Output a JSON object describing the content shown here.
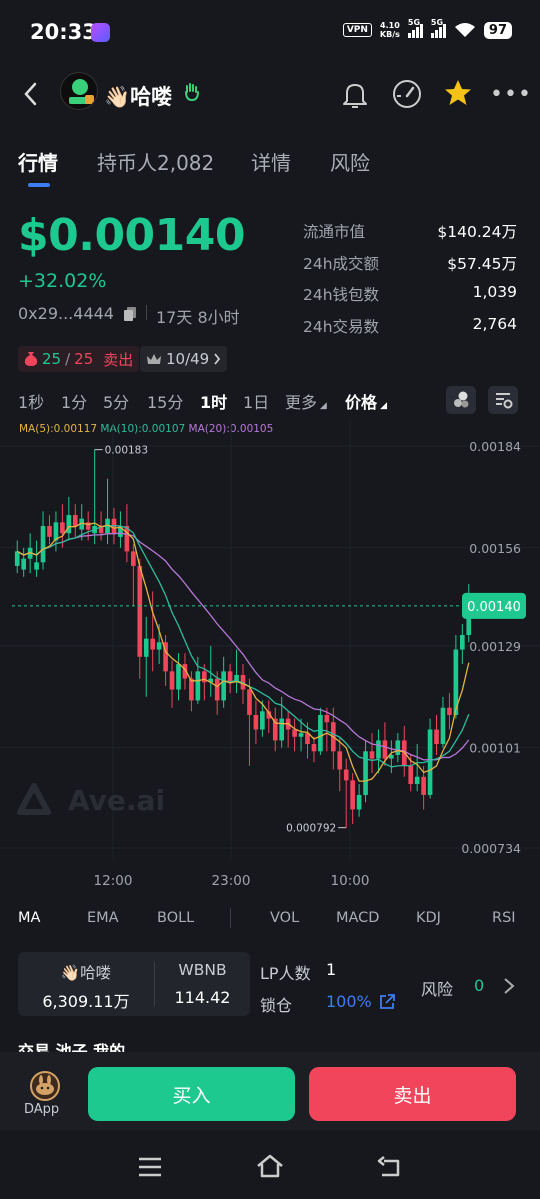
{
  "status_bar": {
    "time": "20:33",
    "vpn": "VPN",
    "speed_value": "4.10",
    "speed_unit": "KB/s",
    "signal_1": "5G",
    "signal_2": "5G",
    "battery": "97"
  },
  "header": {
    "token_name": "👋🏻哈喽",
    "avatar_text": "哈喽"
  },
  "tabs": [
    "行情",
    "持币人2,082",
    "详情",
    "风险"
  ],
  "price": {
    "value": "$0.00140",
    "change": "+32.02%",
    "address": "0x29...4444",
    "age": "17天 8小时"
  },
  "stats": [
    {
      "label": "流通市值",
      "value": "$140.24万"
    },
    {
      "label": "24h成交额",
      "value": "$57.45万"
    },
    {
      "label": "24h钱包数",
      "value": "1,039"
    },
    {
      "label": "24h交易数",
      "value": "2,764"
    }
  ],
  "badges": {
    "buy_count": "25",
    "sep": "/",
    "sell_count": "25",
    "sell_label": "卖出",
    "rank": "10/49"
  },
  "intervals": [
    "1秒",
    "1分",
    "5分",
    "15分",
    "1时",
    "1日",
    "更多",
    "价格"
  ],
  "ma_legend": {
    "ma5": "MA(5):0.00117",
    "ma10": "MA(10):0.00107",
    "ma20": "MA(20):0.00105"
  },
  "chart_data": {
    "type": "candlestick",
    "y_ticks": [
      "0.00184",
      "0.00156",
      "0.00129",
      "0.00101",
      "0.000734"
    ],
    "x_ticks": [
      "12:00",
      "23:00",
      "10:00"
    ],
    "current_price_label": "0.00140",
    "max_label": "0.00183",
    "min_label": "0.000792",
    "watermark": "Ave.ai",
    "ylim": [
      0.000734,
      0.00184
    ],
    "candles": [
      [
        0.00151,
        0.00155,
        0.00149,
        0.00158
      ],
      [
        0.0015,
        0.00153,
        0.00148,
        0.00156
      ],
      [
        0.00153,
        0.00156,
        0.00149,
        0.0016
      ],
      [
        0.0015,
        0.00152,
        0.00148,
        0.00158
      ],
      [
        0.00152,
        0.00162,
        0.0015,
        0.00166
      ],
      [
        0.00162,
        0.00159,
        0.00157,
        0.00165
      ],
      [
        0.00158,
        0.00163,
        0.00155,
        0.00166
      ],
      [
        0.00163,
        0.0016,
        0.00156,
        0.00168
      ],
      [
        0.0016,
        0.00165,
        0.00158,
        0.0017
      ],
      [
        0.00165,
        0.00162,
        0.00159,
        0.00168
      ],
      [
        0.00161,
        0.00164,
        0.00158,
        0.00168
      ],
      [
        0.00163,
        0.00161,
        0.00158,
        0.00166
      ],
      [
        0.0016,
        0.00162,
        0.00157,
        0.00183
      ],
      [
        0.00162,
        0.0016,
        0.00158,
        0.00166
      ],
      [
        0.0016,
        0.00164,
        0.00157,
        0.00175
      ],
      [
        0.00164,
        0.0016,
        0.00157,
        0.00167
      ],
      [
        0.00159,
        0.00162,
        0.00156,
        0.00166
      ],
      [
        0.00162,
        0.00155,
        0.00152,
        0.00168
      ],
      [
        0.00155,
        0.00151,
        0.0014,
        0.00157
      ],
      [
        0.00151,
        0.00126,
        0.0012,
        0.00153
      ],
      [
        0.00126,
        0.00131,
        0.00115,
        0.00137
      ],
      [
        0.00131,
        0.00128,
        0.00122,
        0.00144
      ],
      [
        0.00128,
        0.0013,
        0.00124,
        0.00135
      ],
      [
        0.0013,
        0.00122,
        0.00118,
        0.00132
      ],
      [
        0.00122,
        0.00117,
        0.00112,
        0.00125
      ],
      [
        0.00117,
        0.00124,
        0.00114,
        0.00127
      ],
      [
        0.00124,
        0.0012,
        0.00117,
        0.00127
      ],
      [
        0.0012,
        0.00114,
        0.00111,
        0.00122
      ],
      [
        0.00114,
        0.00122,
        0.00113,
        0.00126
      ],
      [
        0.00122,
        0.00119,
        0.00114,
        0.00124
      ],
      [
        0.00119,
        0.0012,
        0.00115,
        0.00129
      ],
      [
        0.0012,
        0.00114,
        0.0011,
        0.00122
      ],
      [
        0.00114,
        0.00122,
        0.00112,
        0.00126
      ],
      [
        0.00122,
        0.00119,
        0.00116,
        0.00124
      ],
      [
        0.00119,
        0.00121,
        0.00116,
        0.00128
      ],
      [
        0.00121,
        0.00117,
        0.00113,
        0.00124
      ],
      [
        0.00117,
        0.0011,
        0.00096,
        0.0012
      ],
      [
        0.0011,
        0.00106,
        0.00102,
        0.00114
      ],
      [
        0.00106,
        0.00111,
        0.00104,
        0.00114
      ],
      [
        0.00111,
        0.00109,
        0.00105,
        0.00114
      ],
      [
        0.00109,
        0.00103,
        0.001,
        0.00112
      ],
      [
        0.00103,
        0.00109,
        0.00101,
        0.00115
      ],
      [
        0.00109,
        0.00106,
        0.00101,
        0.00111
      ],
      [
        0.00106,
        0.00104,
        0.001,
        0.00109
      ],
      [
        0.00104,
        0.00105,
        0.001,
        0.00109
      ],
      [
        0.00105,
        0.00102,
        0.00098,
        0.00108
      ],
      [
        0.00102,
        0.001,
        0.00097,
        0.00104
      ],
      [
        0.001,
        0.0011,
        0.00099,
        0.00112
      ],
      [
        0.0011,
        0.00108,
        0.001,
        0.00112
      ],
      [
        0.00108,
        0.001,
        0.00095,
        0.00112
      ],
      [
        0.001,
        0.00095,
        0.00089,
        0.00104
      ],
      [
        0.00095,
        0.00092,
        0.00079,
        0.00098
      ],
      [
        0.00092,
        0.00084,
        0.0008,
        0.00094
      ],
      [
        0.00084,
        0.00088,
        0.00082,
        0.00091
      ],
      [
        0.00088,
        0.001,
        0.00086,
        0.00103
      ],
      [
        0.001,
        0.00098,
        0.00094,
        0.00105
      ],
      [
        0.00098,
        0.00103,
        0.00094,
        0.00106
      ],
      [
        0.00103,
        0.00098,
        0.00096,
        0.00108
      ],
      [
        0.00098,
        0.00099,
        0.00094,
        0.00103
      ],
      [
        0.00099,
        0.00103,
        0.00097,
        0.00105
      ],
      [
        0.00103,
        0.00096,
        0.00093,
        0.00107
      ],
      [
        0.00096,
        0.00091,
        0.00089,
        0.00099
      ],
      [
        0.00091,
        0.00093,
        0.00089,
        0.00102
      ],
      [
        0.00093,
        0.00088,
        0.00084,
        0.00096
      ],
      [
        0.00088,
        0.00106,
        0.00087,
        0.00109
      ],
      [
        0.00106,
        0.00102,
        0.00099,
        0.0011
      ],
      [
        0.00102,
        0.00112,
        0.00101,
        0.00115
      ],
      [
        0.00112,
        0.0011,
        0.00106,
        0.00116
      ],
      [
        0.0011,
        0.00128,
        0.00109,
        0.00132
      ],
      [
        0.00128,
        0.00132,
        0.00124,
        0.00135
      ],
      [
        0.00132,
        0.0014,
        0.0013,
        0.00146
      ]
    ]
  },
  "indicators": [
    "MA",
    "EMA",
    "BOLL",
    "VOL",
    "MACD",
    "KDJ",
    "RSI"
  ],
  "pool": {
    "token_label": "👋🏻哈喽",
    "token_amount": "6,309.11万",
    "quote_label": "WBNB",
    "quote_amount": "114.42",
    "lp_label": "LP人数",
    "lp_value": "1",
    "lock_label": "锁仓",
    "lock_value": "100%",
    "risk_label": "风险",
    "risk_value": "0"
  },
  "bottom_tabs": "交易  池子  我的",
  "actions": {
    "dapp": "DApp",
    "buy": "买入",
    "sell": "卖出"
  },
  "colors": {
    "up": "#1ec990",
    "down": "#f0455b",
    "ma5": "#e3b341",
    "ma10": "#2bbd9c",
    "ma20": "#b678d8",
    "accent": "#3c7cf4"
  }
}
